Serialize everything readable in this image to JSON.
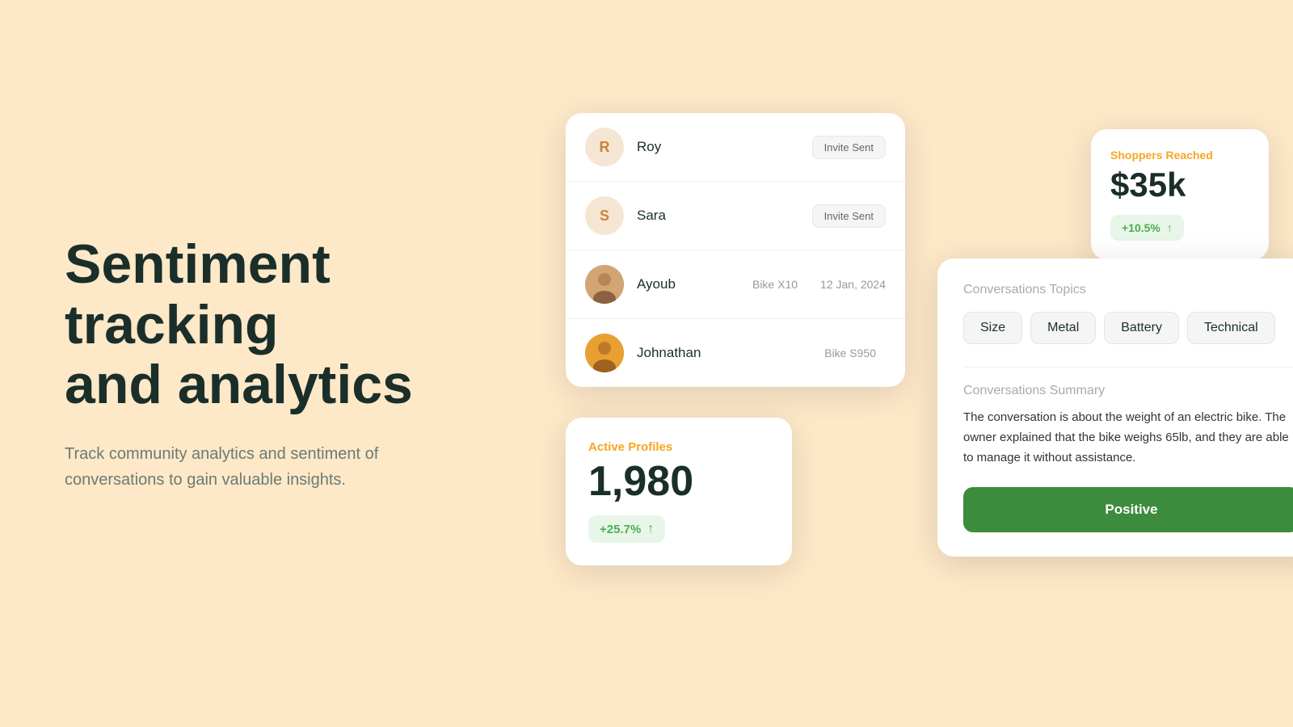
{
  "hero": {
    "heading_line1": "Sentiment tracking",
    "heading_line2": "and analytics",
    "subtext": "Track community analytics and sentiment of conversations to gain valuable insights."
  },
  "users_card": {
    "rows": [
      {
        "id": "roy",
        "initials": "R",
        "name": "Roy",
        "badge": "Invite Sent",
        "bike": "",
        "date": ""
      },
      {
        "id": "sara",
        "initials": "S",
        "name": "Sara",
        "badge": "Invite Sent",
        "bike": "",
        "date": ""
      },
      {
        "id": "ayoub",
        "initials": "",
        "name": "Ayoub",
        "badge": "",
        "bike": "Bike X10",
        "date": "12 Jan, 2024"
      },
      {
        "id": "johnathan",
        "initials": "",
        "name": "Johnathan",
        "badge": "",
        "bike": "Bike S950",
        "date": ""
      }
    ]
  },
  "active_profiles": {
    "label": "Active Profiles",
    "number": "1,980",
    "growth": "+25.7%"
  },
  "shoppers_reached": {
    "label": "Shoppers Reached",
    "amount": "$35k",
    "growth": "+10.5%"
  },
  "conversations": {
    "topics_title": "Conversations Topics",
    "topics": [
      "Size",
      "Metal",
      "Battery",
      "Technical"
    ],
    "summary_title": "Conversations Summary",
    "summary_text": "The conversation is about the weight of an electric bike. The owner explained that the bike weighs 65lb, and they are able to manage it without assistance.",
    "sentiment_label": "Positive"
  }
}
